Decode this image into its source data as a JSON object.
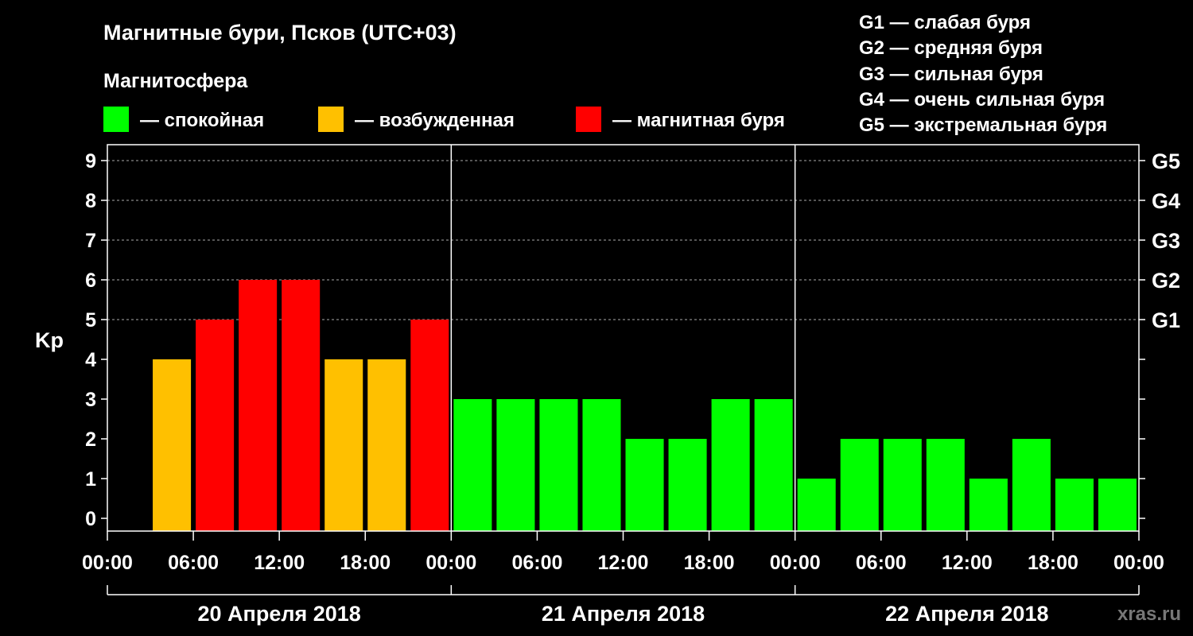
{
  "chart_data": {
    "type": "bar",
    "title": "Магнитные бури, Псков (UTC+03)",
    "legend_title": "Магнитосфера",
    "legend": [
      {
        "label": "— спокойная",
        "color": "#00ff00"
      },
      {
        "label": "— возбужденная",
        "color": "#ffc000"
      },
      {
        "label": "— магнитная буря",
        "color": "#ff0000"
      }
    ],
    "g_scale": [
      "G1 — слабая буря",
      "G2 — средняя буря",
      "G3 — сильная буря",
      "G4 — очень сильная буря",
      "G5 — экстремальная буря"
    ],
    "ylabel": "Kp",
    "ylim": [
      0,
      9
    ],
    "yticks": [
      "0",
      "1",
      "2",
      "3",
      "4",
      "5",
      "6",
      "7",
      "8",
      "9"
    ],
    "right_ticks": [
      {
        "value": 5,
        "label": "G1"
      },
      {
        "value": 6,
        "label": "G2"
      },
      {
        "value": 7,
        "label": "G3"
      },
      {
        "value": 8,
        "label": "G4"
      },
      {
        "value": 9,
        "label": "G5"
      }
    ],
    "xticks": [
      "00:00",
      "06:00",
      "12:00",
      "18:00",
      "00:00",
      "06:00",
      "12:00",
      "18:00",
      "00:00",
      "06:00",
      "12:00",
      "18:00",
      "00:00"
    ],
    "days": [
      "20 Апреля 2018",
      "21 Апреля 2018",
      "22 Апреля 2018"
    ],
    "interval_hours": 3,
    "values": [
      null,
      4,
      5,
      6,
      6,
      4,
      4,
      5,
      3,
      3,
      3,
      3,
      2,
      2,
      3,
      3,
      1,
      2,
      2,
      2,
      1,
      2,
      1,
      1
    ],
    "thresholds": {
      "excited": 4,
      "storm": 5
    },
    "colors": {
      "quiet": "#00ff00",
      "excited": "#ffc000",
      "storm": "#ff0000"
    },
    "grid": "dashed horizontal"
  },
  "watermark": "xras.ru"
}
